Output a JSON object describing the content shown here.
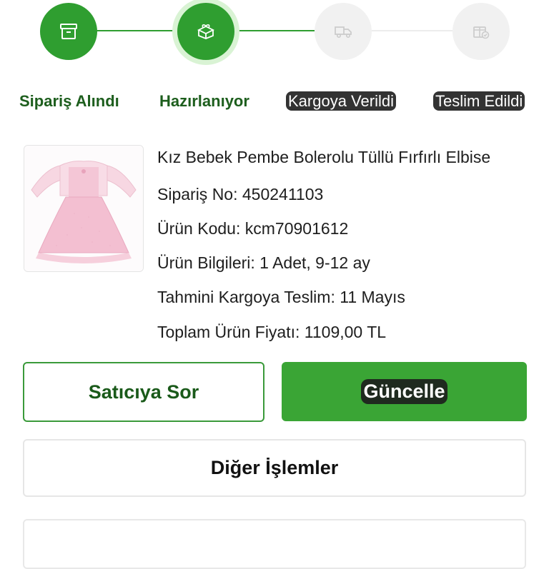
{
  "stepper": {
    "steps": [
      {
        "label": "Sipariş Alındı",
        "icon": "archive-box-icon",
        "status": "done"
      },
      {
        "label": "Hazırlanıyor",
        "icon": "gift-box-icon",
        "status": "current"
      },
      {
        "label": "Kargoya Verildi",
        "icon": "delivery-truck-icon",
        "status": "todo"
      },
      {
        "label": "Teslim Edildi",
        "icon": "delivered-package-icon",
        "status": "todo"
      }
    ],
    "colors": {
      "done": "#2f9e30",
      "todo": "#f1f1f1",
      "label_done": "#1d5e1d"
    }
  },
  "product": {
    "image_alt": "pink baby dress with bolero",
    "name": "Kız Bebek Pembe Bolerolu Tüllü Fırfırlı Elbise",
    "order_no": "Sipariş No: 450241103",
    "product_code": "Ürün Kodu: kcm70901612",
    "product_info": "Ürün Bilgileri: 1 Adet, 9-12 ay",
    "estimated_shipping": "Tahmini Kargoya Teslim: 11 Mayıs",
    "total_price": "Toplam Ürün Fiyatı: 1109,00 TL"
  },
  "actions": {
    "ask_seller": "Satıcıya Sor",
    "update": "Güncelle",
    "other_actions": "Diğer İşlemler"
  },
  "bottom": {
    "text": ""
  }
}
